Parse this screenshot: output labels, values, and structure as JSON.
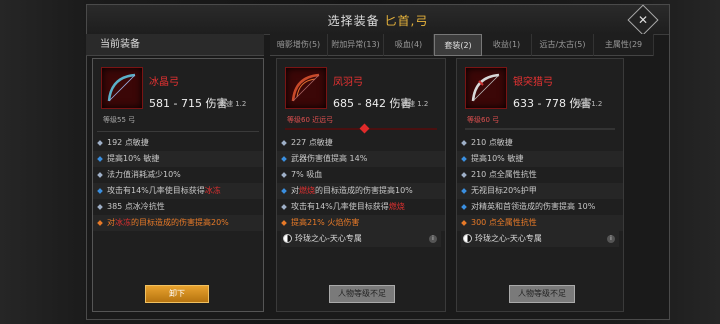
{
  "title": {
    "prefix": "选择装备",
    "highlight": "匕首,弓"
  },
  "current_header": "当前装备",
  "tabs": [
    {
      "label": "暗影增伤(5)",
      "active": false
    },
    {
      "label": "附加异常(13)",
      "active": false
    },
    {
      "label": "吸血(4)",
      "active": false
    },
    {
      "label": "套装(2)",
      "active": true
    },
    {
      "label": "收益(1)",
      "active": false
    },
    {
      "label": "远古/太古(5)",
      "active": false
    },
    {
      "label": "主属性(29",
      "active": false
    }
  ],
  "cards": [
    {
      "name": "冰晶弓",
      "damage": "581 - 715 伤害",
      "speed": "攻速 1.2",
      "requirement": "等级55 弓",
      "stats": [
        "192 点敏捷",
        "提高10% 敏捷",
        "法力值消耗减少10%"
      ],
      "stat_chilled": {
        "pre": "攻击有14%几率使目标获得",
        "hl": "冰冻",
        "post": ""
      },
      "stat_cold": "385 点冰冷抗性",
      "stat_bonus": {
        "pre": "对",
        "hl": "冰冻",
        "post": "的目标造成的伤害提高20%"
      },
      "button": "卸下"
    },
    {
      "name": "凤羽弓",
      "damage": "685 - 842 伤害",
      "speed": "攻速 1.2",
      "requirement": "等级60 近远弓",
      "stats": [
        "227 点敏捷",
        "武器伤害值提高 14%",
        "7% 吸血"
      ],
      "stat_burn_bonus": {
        "pre": "对",
        "hl": "燃烧",
        "post": "的目标造成的伤害提高10%"
      },
      "stat_burn": {
        "pre": "攻击有14%几率使目标获得",
        "hl": "燃烧",
        "post": ""
      },
      "stat_fire": "提高21% 火焰伤害",
      "set": "玲珑之心-天心专属",
      "button": "人物等级不足"
    },
    {
      "name": "银突猎弓",
      "damage": "633 - 778 伤害",
      "speed": "攻速 1.2",
      "requirement": "等级60 弓",
      "stats": [
        "210 点敏捷",
        "提高10% 敏捷",
        "210 点全属性抗性",
        "无视目标20%护甲",
        "对精英和首领造成的伤害提高 10%"
      ],
      "stat_resist": "300 点全属性抗性",
      "set": "玲珑之心-天心专属",
      "button": "人物等级不足"
    }
  ],
  "colors": {
    "accent": "#e8b43c",
    "item_name": "#e83232",
    "blue_stat": "#3a8fe0",
    "orange_stat": "#e87a28"
  }
}
